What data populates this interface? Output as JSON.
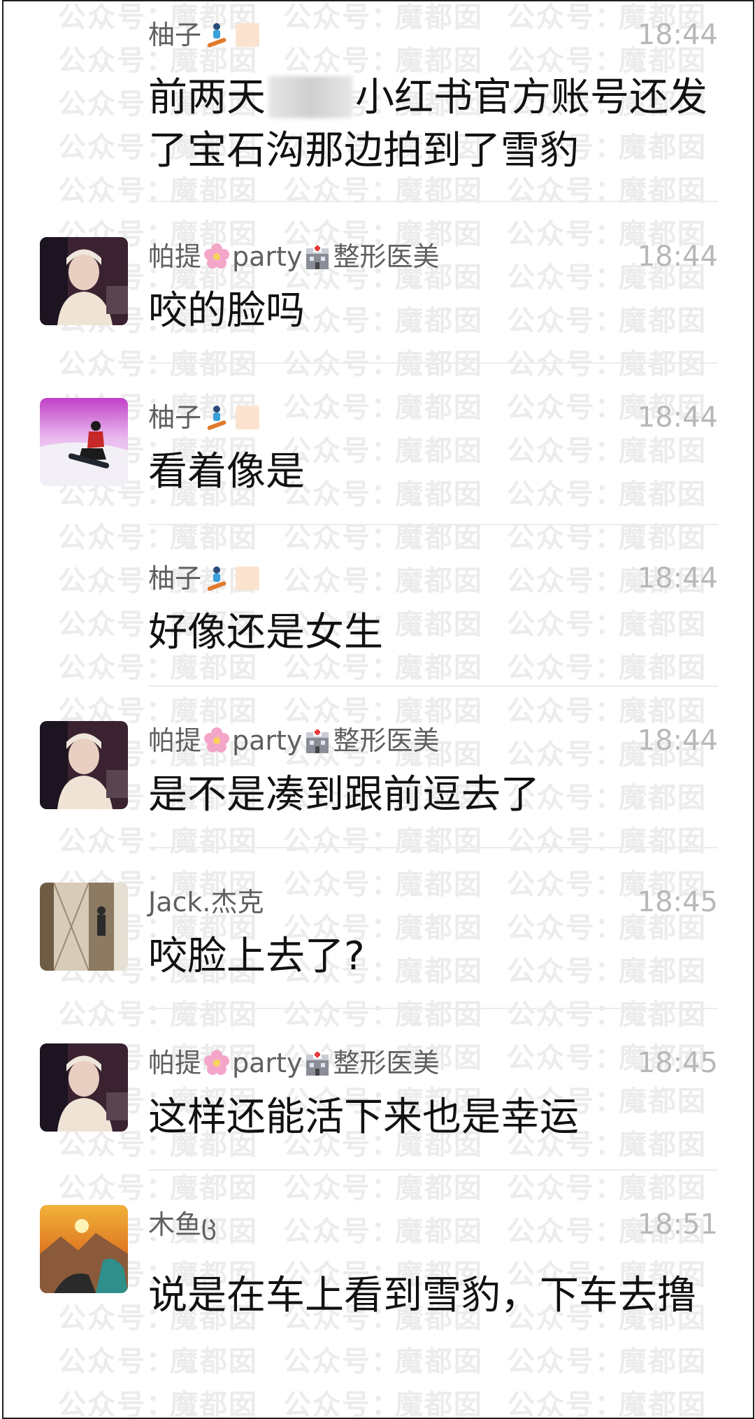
{
  "watermark": {
    "text_a": "公众号：",
    "text_b": "魔都囡"
  },
  "messages": [
    {
      "sender": "柚子",
      "time": "18:44",
      "text_before": "前两天",
      "text_after": "小红书官方账号还发了宝石沟那边拍到了雪豹",
      "avatar": "none",
      "emojis": [
        "snowboarder-emoji",
        "peach-square-emoji"
      ]
    },
    {
      "sender_a": "帕提",
      "sender_b": "party",
      "sender_c": "整形医美",
      "time": "18:44",
      "text": "咬的脸吗",
      "avatar": "woman-portrait"
    },
    {
      "sender": "柚子",
      "time": "18:44",
      "text": "看着像是",
      "avatar": "snowboard-photo"
    },
    {
      "sender": "柚子",
      "time": "18:44",
      "text": "好像还是女生",
      "avatar": "none"
    },
    {
      "sender_a": "帕提",
      "sender_b": "party",
      "sender_c": "整形医美",
      "time": "18:44",
      "text": "是不是凑到跟前逗去了",
      "avatar": "woman-portrait"
    },
    {
      "sender": "Jack.杰克",
      "time": "18:45",
      "text": "咬脸上去了?",
      "avatar": "mirror-room-photo"
    },
    {
      "sender_a": "帕提",
      "sender_b": "party",
      "sender_c": "整形医美",
      "time": "18:45",
      "text": "这样还能活下来也是幸运",
      "avatar": "woman-portrait"
    },
    {
      "sender": "木鱼ც",
      "time": "18:51",
      "text": "说是在车上看到雪豹，下车去撸",
      "avatar": "mountain-sunset-photo"
    }
  ]
}
